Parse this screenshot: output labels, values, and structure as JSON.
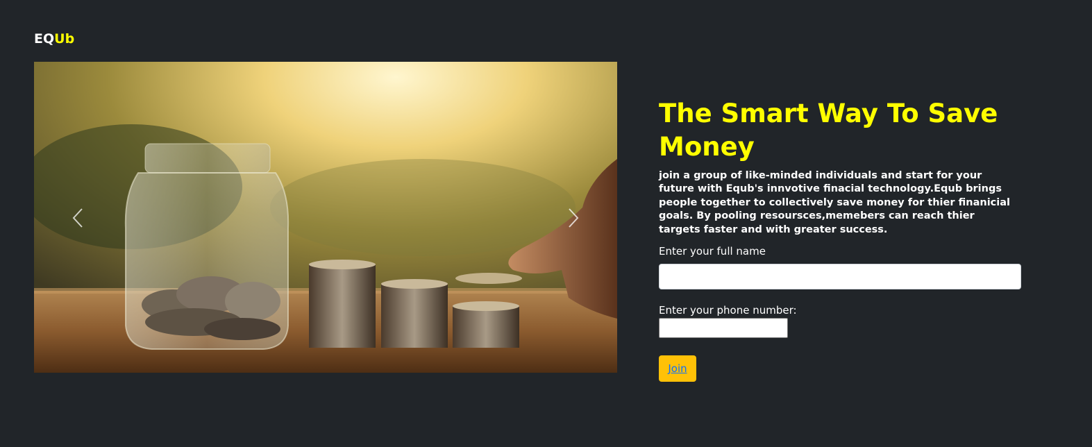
{
  "brand": {
    "part1": "EQ",
    "part2": "Ub"
  },
  "carousel": {
    "prev_icon": "chevron-left-icon",
    "next_icon": "chevron-right-icon",
    "image": "coins-jar-savings-photo"
  },
  "hero": {
    "title": "The Smart Way To Save Money",
    "description": "join a group of like-minded individuals and start for your future with Equb's innvotive finacial technology.Equb brings people together to collectively save money for thier finanicial goals. By pooling resoursces,memebers can reach thier targets faster and with greater success."
  },
  "form": {
    "name_label": "Enter your full name",
    "name_value": "",
    "phone_label": "Enter your phone number:",
    "phone_value": "",
    "join_label": "Join"
  },
  "colors": {
    "background": "#212529",
    "accent": "#ffff00",
    "button": "#ffc107",
    "link": "#0d6efd"
  }
}
